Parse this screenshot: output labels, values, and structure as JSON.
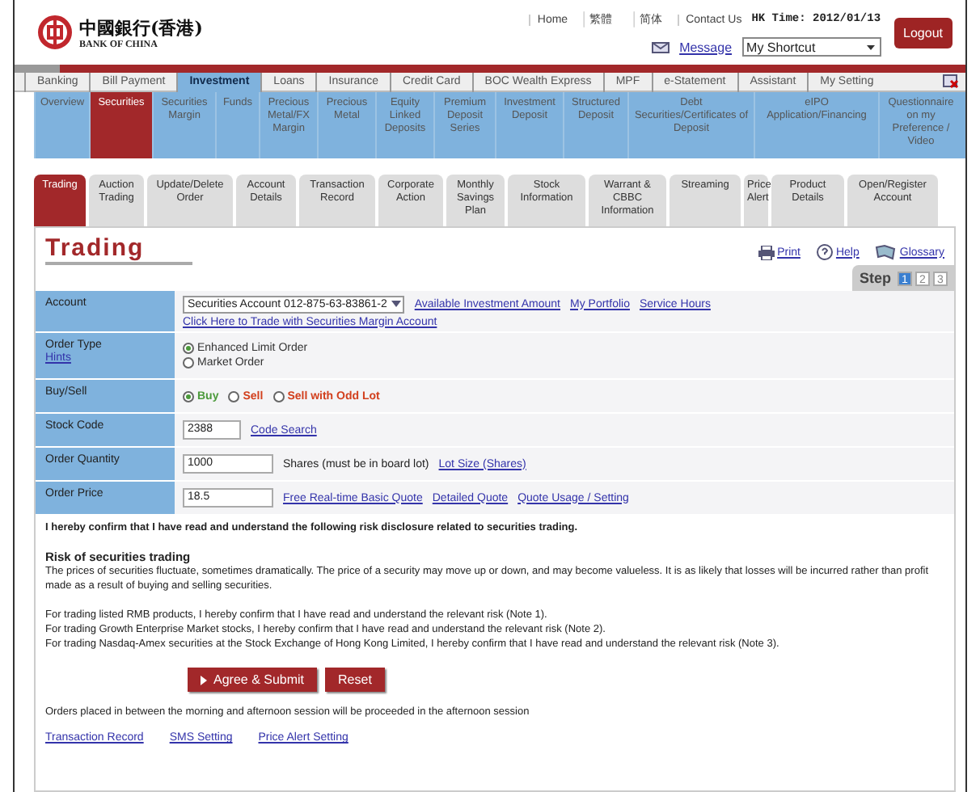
{
  "header": {
    "logo_cn": "中國銀行(香港)",
    "logo_en": "BANK OF CHINA",
    "top_links": [
      "Home",
      "繁體",
      "简体",
      "Contact Us"
    ],
    "hk_time": "HK Time: 2012/01/13",
    "message": "Message",
    "shortcut": "My Shortcut",
    "logout": "Logout"
  },
  "main_nav": [
    {
      "label": "Banking",
      "selected": false
    },
    {
      "label": "Bill Payment",
      "selected": false
    },
    {
      "label": "Investment",
      "selected": true
    },
    {
      "label": "Loans",
      "selected": false
    },
    {
      "label": "Insurance",
      "selected": false
    },
    {
      "label": "Credit Card",
      "selected": false
    },
    {
      "label": "BOC Wealth Express",
      "selected": false
    },
    {
      "label": "MPF",
      "selected": false
    },
    {
      "label": "e-Statement",
      "selected": false
    },
    {
      "label": "Assistant",
      "selected": false
    },
    {
      "label": "My Setting",
      "selected": false
    }
  ],
  "sub_nav": [
    {
      "label": "Overview",
      "selected": false
    },
    {
      "label": "Securities",
      "selected": true
    },
    {
      "label": "Securities Margin",
      "selected": false
    },
    {
      "label": "Funds",
      "selected": false
    },
    {
      "label": "Precious Metal/FX Margin",
      "selected": false
    },
    {
      "label": "Precious Metal",
      "selected": false
    },
    {
      "label": "Equity Linked Deposits",
      "selected": false
    },
    {
      "label": "Premium Deposit Series",
      "selected": false
    },
    {
      "label": "Investment Deposit",
      "selected": false
    },
    {
      "label": "Structured Deposit",
      "selected": false
    },
    {
      "label": "Debt Securities/Certificates of Deposit",
      "selected": false
    },
    {
      "label": "eIPO Application/Financing",
      "selected": false
    },
    {
      "label": "Questionnaire on my Preference / Video",
      "selected": false
    }
  ],
  "section_tabs": [
    {
      "label": "Trading",
      "selected": true
    },
    {
      "label": "Auction Trading",
      "selected": false
    },
    {
      "label": "Update/Delete Order",
      "selected": false
    },
    {
      "label": "Account Details",
      "selected": false
    },
    {
      "label": "Transaction Record",
      "selected": false
    },
    {
      "label": "Corporate Action",
      "selected": false
    },
    {
      "label": "Monthly Savings Plan",
      "selected": false
    },
    {
      "label": "Stock Information",
      "selected": false
    },
    {
      "label": "Warrant & CBBC Information",
      "selected": false
    },
    {
      "label": "Streaming",
      "selected": false
    },
    {
      "label": "Price Alert",
      "selected": false
    },
    {
      "label": "Product Details",
      "selected": false
    },
    {
      "label": "Open/Register Account",
      "selected": false
    }
  ],
  "panel": {
    "title": "Trading",
    "tools": [
      "Print",
      "Help",
      "Glossary"
    ],
    "step": {
      "label": "Step",
      "items": [
        {
          "label": "1",
          "selected": true
        },
        {
          "label": "2",
          "selected": false
        },
        {
          "label": "3",
          "selected": false
        }
      ]
    }
  },
  "form": [
    {
      "kind": "account",
      "label": "Account",
      "value": "Securities Account 012-875-63-83861-2",
      "links": [
        "Available Investment Amount",
        "My Portfolio",
        "Service Hours"
      ],
      "sublink": "Click Here to Trade with Securities Margin Account"
    },
    {
      "kind": "radio_list",
      "label": "Order Type",
      "hint": "Hints",
      "options": [
        {
          "label": "Enhanced Limit Order",
          "selected": true,
          "color": "#333333"
        },
        {
          "label": "Market Order",
          "selected": false,
          "color": "#333333"
        }
      ]
    },
    {
      "kind": "radio_inline",
      "label": "Buy/Sell",
      "options": [
        {
          "label": "Buy",
          "selected": true,
          "color": "#4c9a3c"
        },
        {
          "label": "Sell",
          "selected": false,
          "color": "#d2401e"
        },
        {
          "label": "Sell with Odd Lot",
          "selected": false,
          "color": "#d2401e"
        }
      ]
    },
    {
      "kind": "short_input",
      "label": "Stock Code",
      "value": "2388",
      "links": [
        "Code Search"
      ]
    },
    {
      "kind": "input",
      "label": "Order Quantity",
      "value": "1000",
      "note": "Shares (must be in board lot)",
      "links": [
        "Lot Size (Shares)"
      ]
    },
    {
      "kind": "input",
      "label": "Order Price",
      "value": "18.5",
      "links": [
        "Free Real-time Basic Quote",
        "Detailed Quote",
        "Quote Usage / Setting"
      ]
    }
  ],
  "disclosure": {
    "confirm": "I hereby confirm that I have read and understand the following risk disclosure related to securities trading.",
    "risk_title": "Risk of securities trading",
    "risk_text": "The prices of securities fluctuate, sometimes dramatically. The price of a security may move up or down, and may become valueless. It is as likely that losses will be incurred rather than profit made as a result of buying and selling securities.",
    "notes": [
      "For trading listed RMB products, I hereby confirm that I have read and understand the relevant risk (Note 1).",
      "For trading Growth Enterprise Market stocks, I hereby confirm that I have read and understand the relevant risk (Note 2).",
      "For trading Nasdaq-Amex securities at the Stock Exchange of Hong Kong Limited, I hereby confirm that I have read and understand the relevant risk (Note 3)."
    ]
  },
  "buttons": {
    "submit": "Agree & Submit",
    "reset": "Reset"
  },
  "session_note": "Orders placed in between the morning and afternoon session will be proceeded in the afternoon session",
  "footer_links": [
    "Transaction Record",
    "SMS Setting",
    "Price Alert Setting"
  ]
}
